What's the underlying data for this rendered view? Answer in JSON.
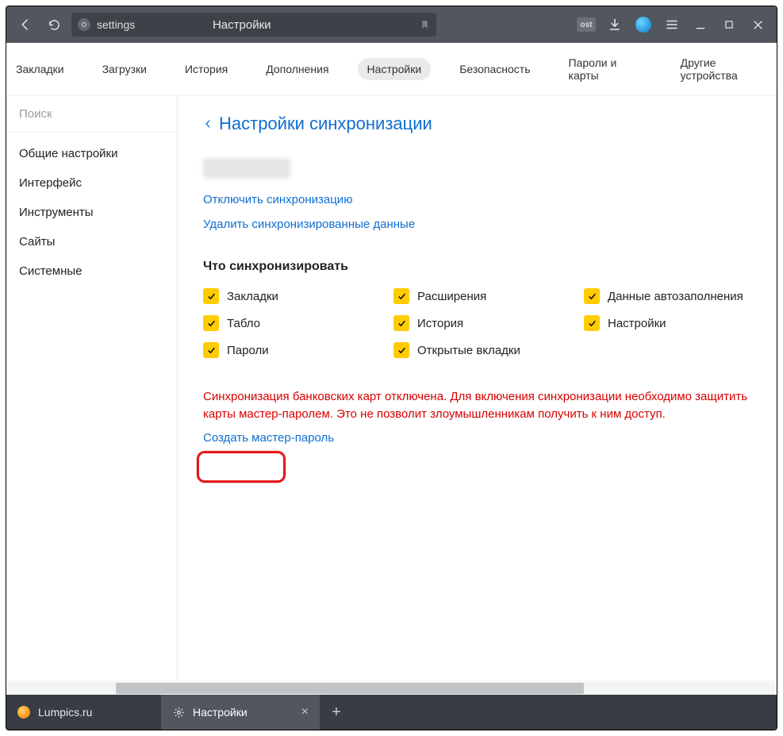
{
  "titlebar": {
    "url_text": "settings",
    "page_title": "Настройки",
    "ext_badge": "ost"
  },
  "topnav": {
    "items": [
      "Закладки",
      "Загрузки",
      "История",
      "Дополнения",
      "Настройки",
      "Безопасность",
      "Пароли и карты",
      "Другие устройства"
    ],
    "active_index": 4
  },
  "sidebar": {
    "search_placeholder": "Поиск",
    "items": [
      "Общие настройки",
      "Интерфейс",
      "Инструменты",
      "Сайты",
      "Системные"
    ]
  },
  "main": {
    "title": "Настройки синхронизации",
    "links": {
      "disable": "Отключить синхронизацию",
      "delete": "Удалить синхронизированные данные"
    },
    "section_title": "Что синхронизировать",
    "checks": {
      "bookmarks": "Закладки",
      "extensions": "Расширения",
      "autofill": "Данные автозаполнения",
      "tablo": "Табло",
      "history": "История",
      "settings": "Настройки",
      "passwords": "Пароли",
      "open_tabs": "Открытые вкладки"
    },
    "warning": "Синхронизация банковских карт отключена. Для включения синхронизации необходимо защитить карты мастер-паролем. Это не позволит злоумышленникам получить к ним доступ.",
    "create_master": "Создать мастер-пароль"
  },
  "tabs": {
    "tab1": "Lumpics.ru",
    "tab2": "Настройки"
  }
}
